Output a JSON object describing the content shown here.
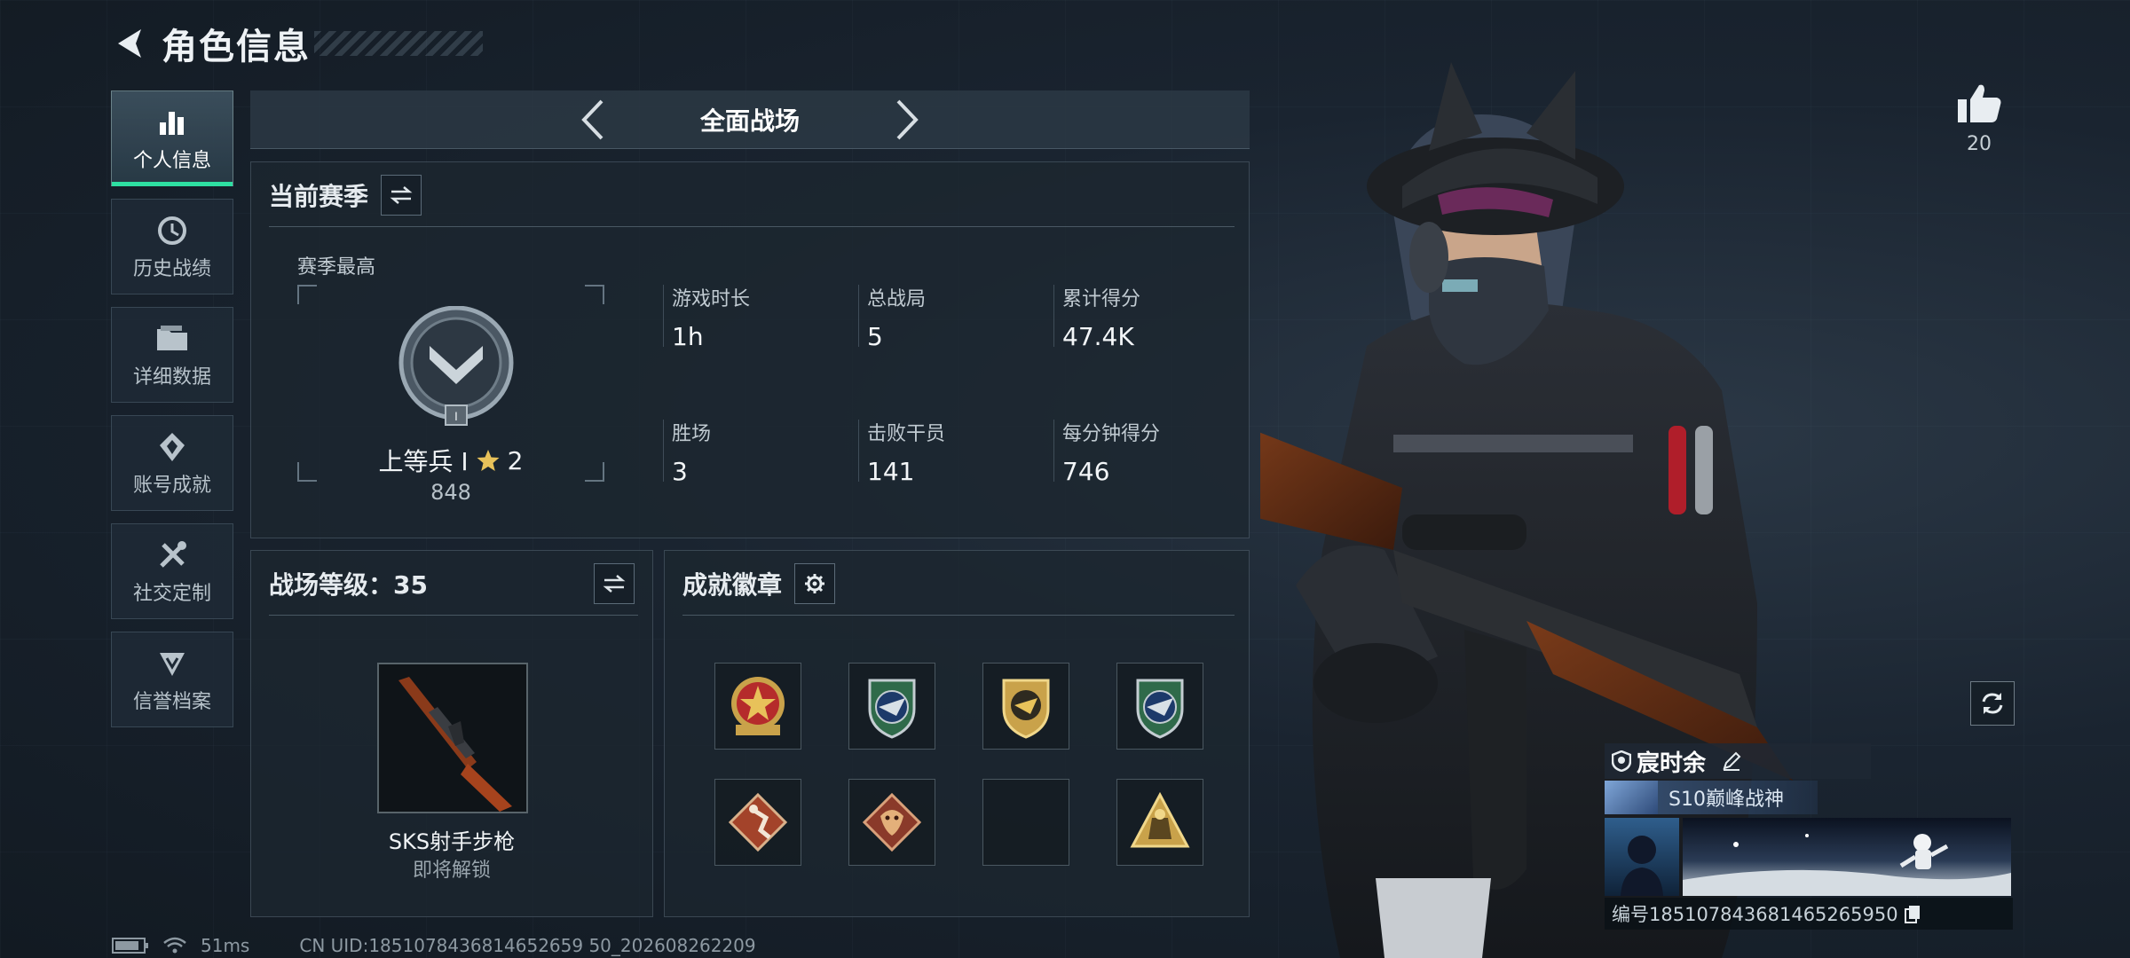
{
  "header": {
    "title": "角色信息"
  },
  "sidebar": {
    "items": [
      {
        "label": "个人信息",
        "icon": "bar-chart-icon",
        "active": true
      },
      {
        "label": "历史战绩",
        "icon": "history-clock-icon",
        "active": false
      },
      {
        "label": "详细数据",
        "icon": "folder-icon",
        "active": false
      },
      {
        "label": "账号成就",
        "icon": "achievement-icon",
        "active": false
      },
      {
        "label": "社交定制",
        "icon": "tools-icon",
        "active": false
      },
      {
        "label": "信誉档案",
        "icon": "reputation-icon",
        "active": false
      }
    ]
  },
  "mode": {
    "title": "全面战场"
  },
  "season": {
    "title": "当前赛季",
    "rank_label": "赛季最高",
    "rank_name": "上等兵 I",
    "rank_stars": "2",
    "rank_score": "848",
    "stats": [
      {
        "label": "游戏时长",
        "value": "1h"
      },
      {
        "label": "总战局",
        "value": "5"
      },
      {
        "label": "累计得分",
        "value": "47.4K"
      },
      {
        "label": "胜场",
        "value": "3"
      },
      {
        "label": "击败干员",
        "value": "141"
      },
      {
        "label": "每分钟得分",
        "value": "746"
      }
    ]
  },
  "level": {
    "title": "战场等级：35",
    "weapon_name": "SKS射手步枪",
    "weapon_status": "即将解锁"
  },
  "badges": {
    "title": "成就徽章",
    "items": [
      {
        "icon": "red-star-medal-icon"
      },
      {
        "icon": "green-shield-wings-icon"
      },
      {
        "icon": "gold-shield-icon"
      },
      {
        "icon": "green-shield-wings-icon"
      },
      {
        "icon": "runner-badge-icon"
      },
      {
        "icon": "dragon-badge-icon"
      },
      {
        "icon": "empty-slot"
      },
      {
        "icon": "gold-triangle-badge-icon"
      }
    ]
  },
  "statusbar": {
    "ping": "51ms",
    "uid": "CN UID:1851078436814652659 50_202608262209"
  },
  "like": {
    "count": "20"
  },
  "player": {
    "name": "宸时余",
    "title": "S10巅峰战神",
    "id": "编号185107843681465265950"
  },
  "colors": {
    "accent": "#2ee0a2",
    "background": "#151d26"
  }
}
